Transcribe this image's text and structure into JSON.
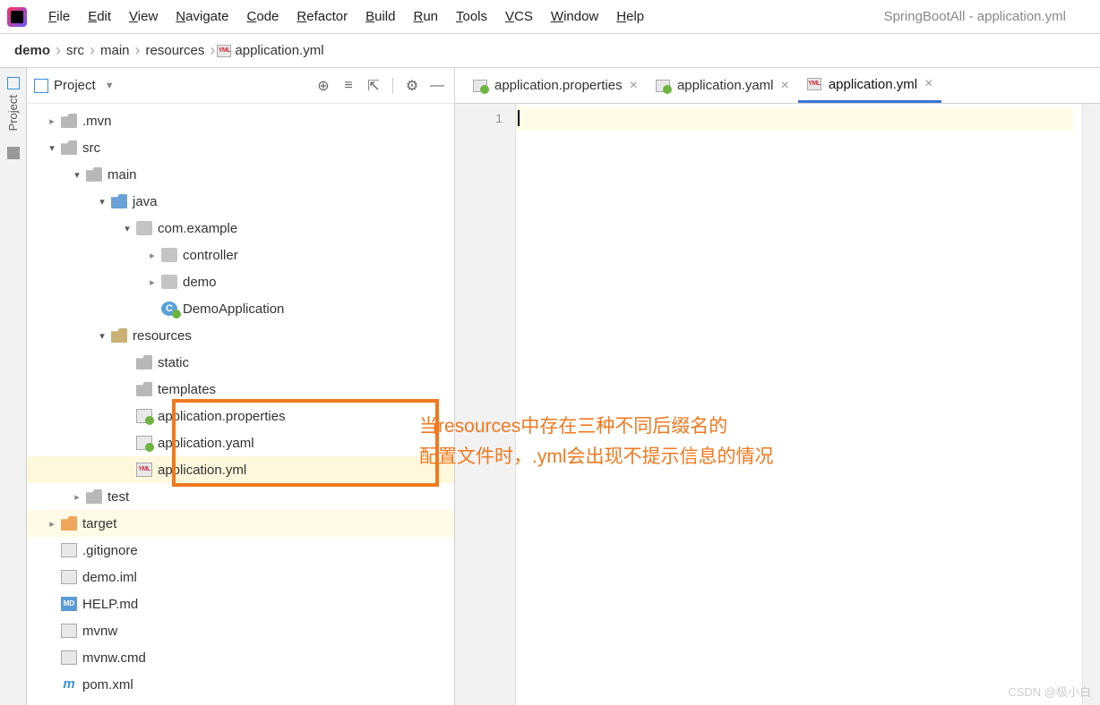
{
  "menubar": [
    "File",
    "Edit",
    "View",
    "Navigate",
    "Code",
    "Refactor",
    "Build",
    "Run",
    "Tools",
    "VCS",
    "Window",
    "Help"
  ],
  "window_title": "SpringBootAll - application.yml",
  "breadcrumb": [
    "demo",
    "src",
    "main",
    "resources",
    "application.yml"
  ],
  "breadcrumb_icon": "yml",
  "sidebar": {
    "title": "Project",
    "left_bar_label": "Project"
  },
  "tree": [
    {
      "depth": 0,
      "arrow": "closed",
      "icon": "folder",
      "label": ".mvn"
    },
    {
      "depth": 0,
      "arrow": "open",
      "icon": "folder",
      "label": "src"
    },
    {
      "depth": 1,
      "arrow": "open",
      "icon": "folder",
      "label": "main"
    },
    {
      "depth": 2,
      "arrow": "open",
      "icon": "folder blue",
      "label": "java"
    },
    {
      "depth": 3,
      "arrow": "open",
      "icon": "pkg",
      "label": "com.example"
    },
    {
      "depth": 4,
      "arrow": "closed",
      "icon": "pkg",
      "label": "controller"
    },
    {
      "depth": 4,
      "arrow": "closed",
      "icon": "pkg",
      "label": "demo"
    },
    {
      "depth": 4,
      "arrow": "none",
      "icon": "class",
      "label": "DemoApplication"
    },
    {
      "depth": 2,
      "arrow": "open",
      "icon": "folder res",
      "label": "resources"
    },
    {
      "depth": 3,
      "arrow": "none",
      "icon": "folder",
      "label": "static"
    },
    {
      "depth": 3,
      "arrow": "none",
      "icon": "folder",
      "label": "templates"
    },
    {
      "depth": 3,
      "arrow": "none",
      "icon": "props",
      "label": "application.properties",
      "boxed": true
    },
    {
      "depth": 3,
      "arrow": "none",
      "icon": "props",
      "label": "application.yaml",
      "boxed": true
    },
    {
      "depth": 3,
      "arrow": "none",
      "icon": "yml",
      "label": "application.yml",
      "boxed": true,
      "sel": true
    },
    {
      "depth": 1,
      "arrow": "closed",
      "icon": "folder",
      "label": "test"
    },
    {
      "depth": 0,
      "arrow": "closed",
      "icon": "folder orange",
      "label": "target",
      "yl": true
    },
    {
      "depth": 0,
      "arrow": "none",
      "icon": "file",
      "label": ".gitignore"
    },
    {
      "depth": 0,
      "arrow": "none",
      "icon": "file",
      "label": "demo.iml"
    },
    {
      "depth": 0,
      "arrow": "none",
      "icon": "md",
      "label": "HELP.md"
    },
    {
      "depth": 0,
      "arrow": "none",
      "icon": "file",
      "label": "mvnw"
    },
    {
      "depth": 0,
      "arrow": "none",
      "icon": "file",
      "label": "mvnw.cmd"
    },
    {
      "depth": 0,
      "arrow": "none",
      "icon": "m",
      "label": "pom.xml"
    }
  ],
  "tabs": [
    {
      "icon": "props",
      "label": "application.properties",
      "active": false
    },
    {
      "icon": "props",
      "label": "application.yaml",
      "active": false
    },
    {
      "icon": "yml",
      "label": "application.yml",
      "active": true
    }
  ],
  "editor": {
    "line_number": "1"
  },
  "annotation": {
    "line1": "当resources中存在三种不同后缀名的",
    "line2": "配置文件时，.yml会出现不提示信息的情况"
  },
  "watermark": "CSDN @极小白"
}
